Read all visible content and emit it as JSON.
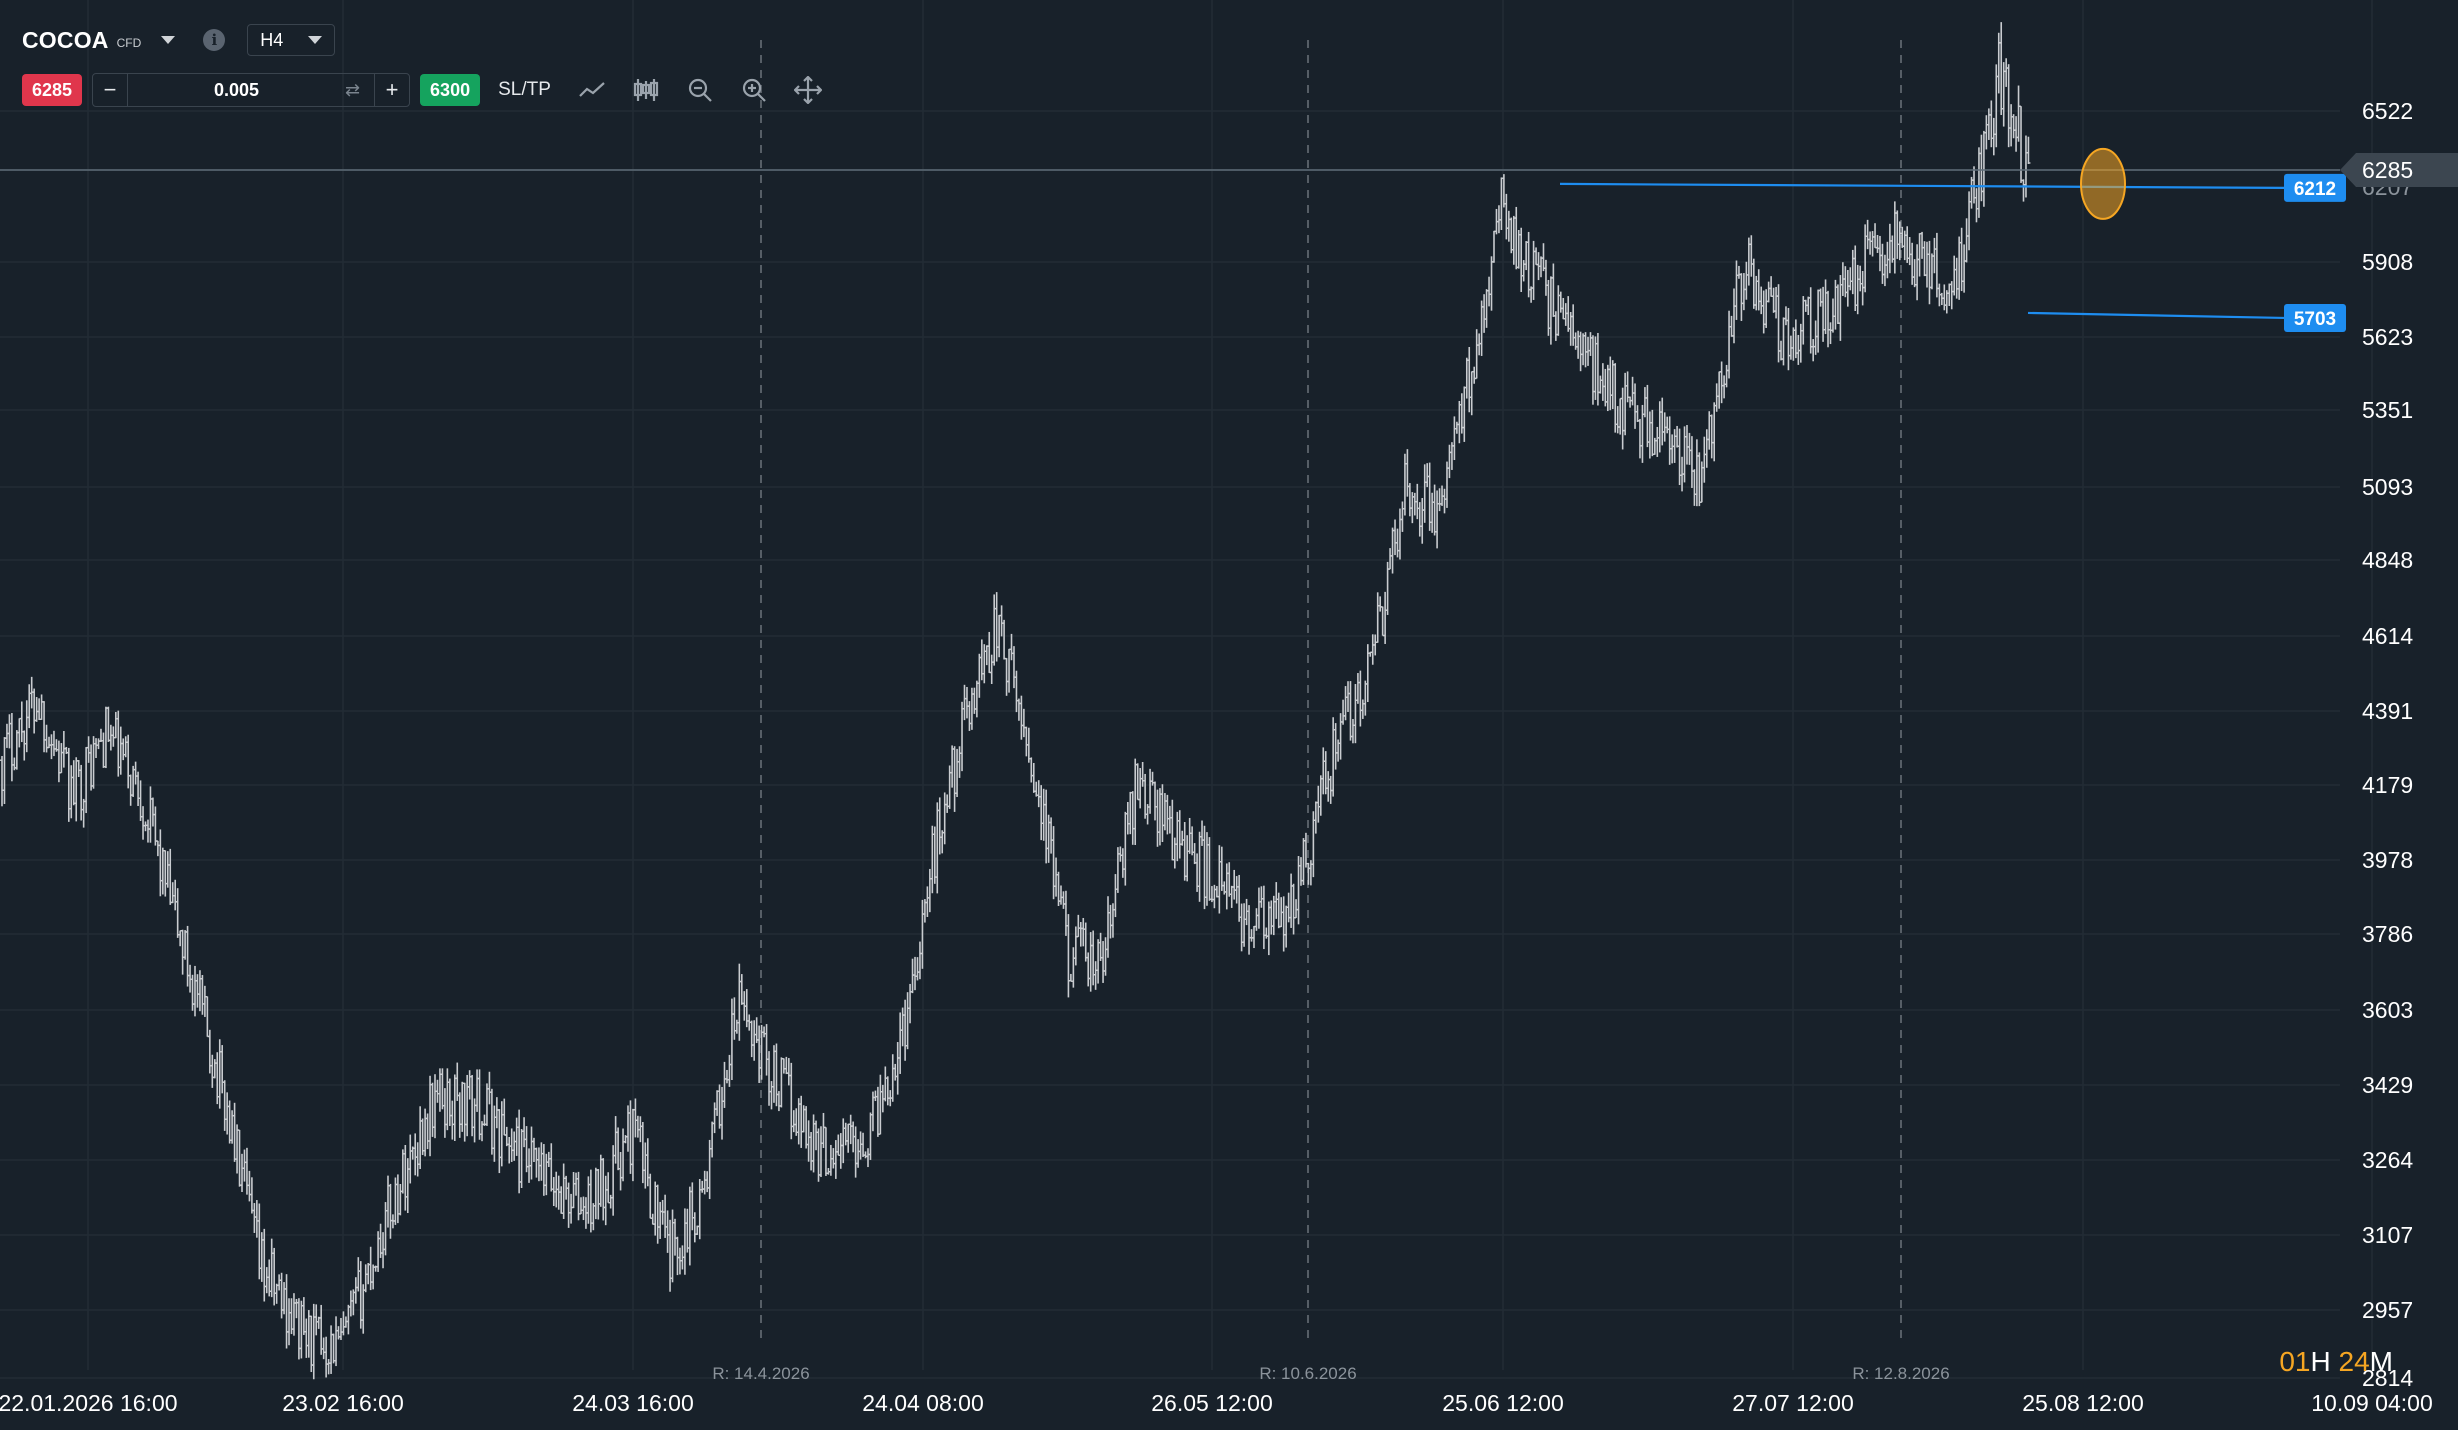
{
  "header": {
    "symbol": "COCOA",
    "instrument_type": "CFD",
    "timeframe": "H4"
  },
  "order_panel": {
    "sell_price": "6285",
    "quantity": "0.005",
    "buy_price": "6300",
    "sltp_label": "SL/TP",
    "minus_label": "−",
    "plus_label": "+"
  },
  "tools": [
    "line-chart-icon",
    "candlestick-icon",
    "zoom-out-icon",
    "zoom-in-icon",
    "crosshair-icon"
  ],
  "colors": {
    "background": "#18212a",
    "grid": "#222c35",
    "candle": "#c9ccd0",
    "sell": "#e0364c",
    "buy": "#15a35e",
    "level_line": "#1e8df0",
    "highlight": "#f5a623",
    "axis_text": "#ffffff"
  },
  "countdown": {
    "h": "01",
    "h_unit": "H",
    "m": "24",
    "m_unit": "M"
  },
  "chart_data": {
    "type": "candlestick",
    "y_ticks": [
      6522,
      6285,
      6207,
      5908,
      5623,
      5351,
      5093,
      4848,
      4614,
      4391,
      4179,
      3978,
      3786,
      3603,
      3429,
      3264,
      3107,
      2957,
      2814
    ],
    "x_ticks": [
      "22.01.2026 16:00",
      "23.02 16:00",
      "24.03 16:00",
      "24.04 08:00",
      "26.05 12:00",
      "25.06 12:00",
      "27.07 12:00",
      "25.08 12:00",
      "10.09 04:00"
    ],
    "rollovers": [
      "R: 14.4.2026",
      "R: 10.6.2026",
      "R: 12.8.2026"
    ],
    "current_price": 6285,
    "levels": [
      {
        "label": "6212",
        "value": 6212
      },
      {
        "label": "5703",
        "value": 5703
      }
    ],
    "price_path": [
      {
        "t": 0,
        "p": 4250
      },
      {
        "t": 0.015,
        "p": 4430
      },
      {
        "t": 0.03,
        "p": 4150
      },
      {
        "t": 0.045,
        "p": 4330
      },
      {
        "t": 0.06,
        "p": 4150
      },
      {
        "t": 0.075,
        "p": 3800
      },
      {
        "t": 0.095,
        "p": 3400
      },
      {
        "t": 0.11,
        "p": 3050
      },
      {
        "t": 0.13,
        "p": 2900
      },
      {
        "t": 0.145,
        "p": 2880
      },
      {
        "t": 0.165,
        "p": 3150
      },
      {
        "t": 0.185,
        "p": 3400
      },
      {
        "t": 0.205,
        "p": 3380
      },
      {
        "t": 0.225,
        "p": 3250
      },
      {
        "t": 0.25,
        "p": 3160
      },
      {
        "t": 0.27,
        "p": 3330
      },
      {
        "t": 0.285,
        "p": 3060
      },
      {
        "t": 0.3,
        "p": 3200
      },
      {
        "t": 0.315,
        "p": 3620
      },
      {
        "t": 0.33,
        "p": 3450
      },
      {
        "t": 0.35,
        "p": 3280
      },
      {
        "t": 0.37,
        "p": 3320
      },
      {
        "t": 0.385,
        "p": 3550
      },
      {
        "t": 0.4,
        "p": 4050
      },
      {
        "t": 0.415,
        "p": 4450
      },
      {
        "t": 0.425,
        "p": 4650
      },
      {
        "t": 0.44,
        "p": 4250
      },
      {
        "t": 0.455,
        "p": 3750
      },
      {
        "t": 0.47,
        "p": 3700
      },
      {
        "t": 0.485,
        "p": 4200
      },
      {
        "t": 0.5,
        "p": 4050
      },
      {
        "t": 0.515,
        "p": 3950
      },
      {
        "t": 0.535,
        "p": 3800
      },
      {
        "t": 0.55,
        "p": 3820
      },
      {
        "t": 0.57,
        "p": 4300
      },
      {
        "t": 0.585,
        "p": 4500
      },
      {
        "t": 0.6,
        "p": 5100
      },
      {
        "t": 0.615,
        "p": 5000
      },
      {
        "t": 0.63,
        "p": 5600
      },
      {
        "t": 0.64,
        "p": 6150
      },
      {
        "t": 0.655,
        "p": 5850
      },
      {
        "t": 0.67,
        "p": 5650
      },
      {
        "t": 0.69,
        "p": 5400
      },
      {
        "t": 0.71,
        "p": 5250
      },
      {
        "t": 0.725,
        "p": 5100
      },
      {
        "t": 0.735,
        "p": 5500
      },
      {
        "t": 0.745,
        "p": 5900
      },
      {
        "t": 0.76,
        "p": 5650
      },
      {
        "t": 0.78,
        "p": 5700
      },
      {
        "t": 0.795,
        "p": 5900
      },
      {
        "t": 0.81,
        "p": 6000
      },
      {
        "t": 0.825,
        "p": 5850
      },
      {
        "t": 0.835,
        "p": 5850
      },
      {
        "t": 0.845,
        "p": 6250
      },
      {
        "t": 0.853,
        "p": 6620
      },
      {
        "t": 0.86,
        "p": 6500
      },
      {
        "t": 0.866,
        "p": 6207
      }
    ]
  }
}
